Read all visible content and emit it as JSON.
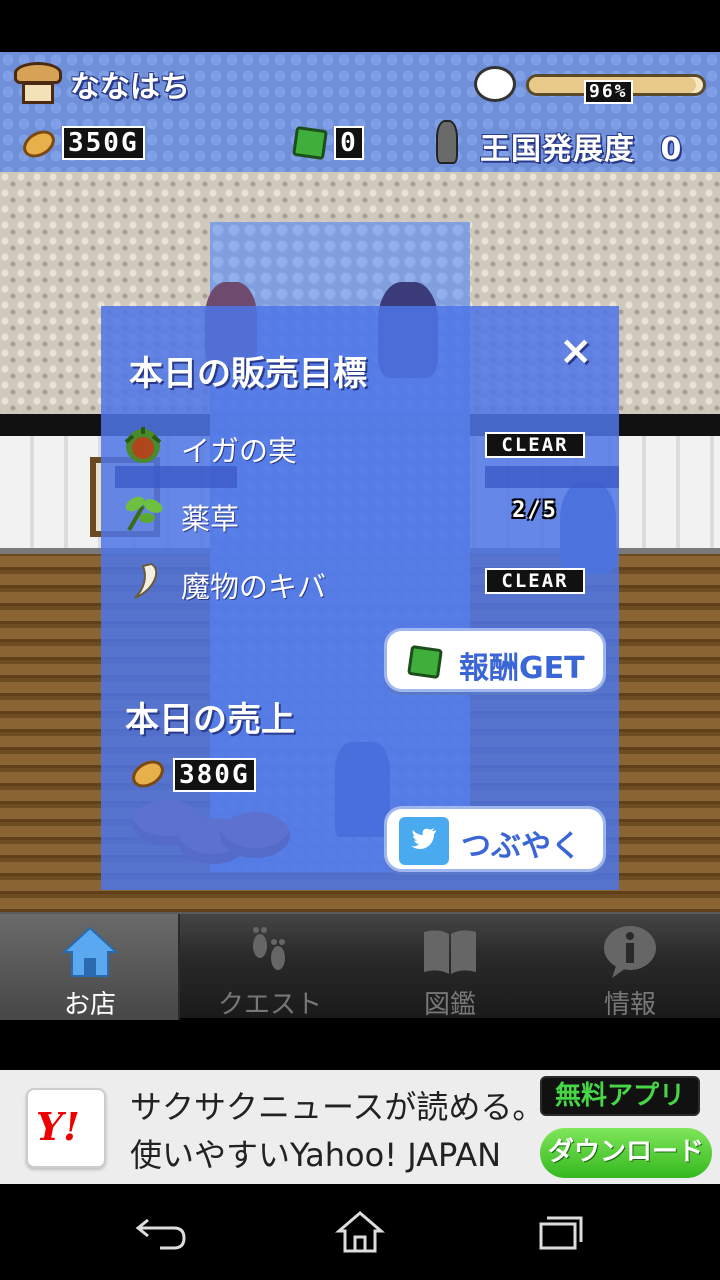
{
  "hud": {
    "shop_name": "ななはち",
    "stamina_text": "96%",
    "stamina_fraction": 0.96,
    "gold": "350G",
    "gems": "0",
    "kingdom_label": "王国発展度",
    "kingdom_value": "0"
  },
  "dialog": {
    "title": "本日の販売目標",
    "close_label": "×",
    "items": [
      {
        "name": "イガの実",
        "status": "CLEAR"
      },
      {
        "name": "薬草",
        "status": "2/5"
      },
      {
        "name": "魔物のキバ",
        "status": "CLEAR"
      }
    ],
    "reward_button": "報酬GET",
    "sales_title": "本日の売上",
    "sales_value": "380G",
    "tweet_button": "つぶやく",
    "tweet_icon": "twitter-bird-icon"
  },
  "tabs": [
    {
      "label": "お店",
      "icon": "house-icon",
      "active": true
    },
    {
      "label": "クエスト",
      "icon": "footprints-icon",
      "active": false
    },
    {
      "label": "図鑑",
      "icon": "book-icon",
      "active": false
    },
    {
      "label": "情報",
      "icon": "info-icon",
      "active": false
    }
  ],
  "ad": {
    "logo": "Y!",
    "line1": "サクサクニュースが読める。",
    "line2": "使いやすいYahoo! JAPAN",
    "badge": "無料アプリ",
    "download": "ダウンロード"
  },
  "navbar": {
    "back_icon": "back-icon",
    "home_icon": "home-icon",
    "recents_icon": "recents-icon"
  },
  "colors": {
    "dialog_bg": "#4e76e6",
    "button_text": "#3b66d6",
    "ad_download": "#34b81f",
    "ad_badge_text": "#46d646"
  }
}
